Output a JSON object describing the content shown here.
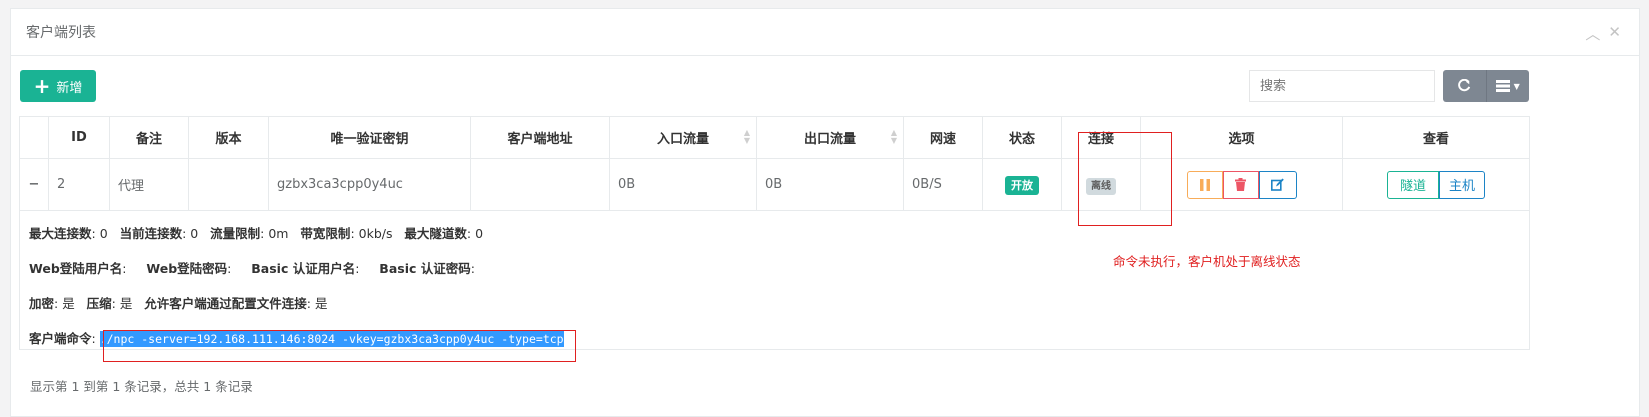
{
  "panel": {
    "title": "客户端列表",
    "tools": {
      "collapse": "︿",
      "close": "✕"
    }
  },
  "toolbar": {
    "add_label": "新增",
    "search_placeholder": "搜索",
    "refresh_icon": "refresh-icon",
    "columns_icon": "columns-icon"
  },
  "table": {
    "headers": [
      "",
      "ID",
      "备注",
      "版本",
      "唯一验证密钥",
      "客户端地址",
      "入口流量",
      "出口流量",
      "网速",
      "状态",
      "连接",
      "选项",
      "查看"
    ],
    "row": {
      "id": "2",
      "remark": "代理",
      "version": "",
      "vkey": "gzbx3ca3cpp0y4uc",
      "address": "",
      "in_flow": "0B",
      "out_flow": "0B",
      "speed": "0B/S",
      "status": "开放",
      "connection": "离线",
      "view_tunnel": "隧道",
      "view_host": "主机"
    },
    "detail": {
      "line1": [
        {
          "label": "最大连接数",
          "value": "0"
        },
        {
          "label": "当前连接数",
          "value": "0"
        },
        {
          "label": "流量限制",
          "value": "0m"
        },
        {
          "label": "带宽限制",
          "value": "0kb/s"
        },
        {
          "label": "最大隧道数",
          "value": "0"
        }
      ],
      "line2": [
        {
          "label": "Web登陆用户名",
          "value": ""
        },
        {
          "label": "Web登陆密码",
          "value": ""
        },
        {
          "label": "Basic 认证用户名",
          "value": ""
        },
        {
          "label": "Basic 认证密码",
          "value": ""
        }
      ],
      "line3": [
        {
          "label": "加密",
          "value": "是"
        },
        {
          "label": "压缩",
          "value": "是"
        },
        {
          "label": "允许客户端通过配置文件连接",
          "value": "是"
        }
      ],
      "cmd_label": "客户端命令",
      "cmd_value": "./npc -server=192.168.111.146:8024 -vkey=gzbx3ca3cpp0y4uc -type=tcp"
    }
  },
  "annotation": {
    "note": "命令未执行，客户机处于离线状态",
    "color": "#e02020"
  },
  "footer": {
    "info": "显示第 1 到第 1 条记录，总共 1 条记录"
  },
  "colors": {
    "primary": "#1ab394",
    "warning": "#f8ac59",
    "danger": "#ed5565",
    "info": "#1c84c6"
  }
}
